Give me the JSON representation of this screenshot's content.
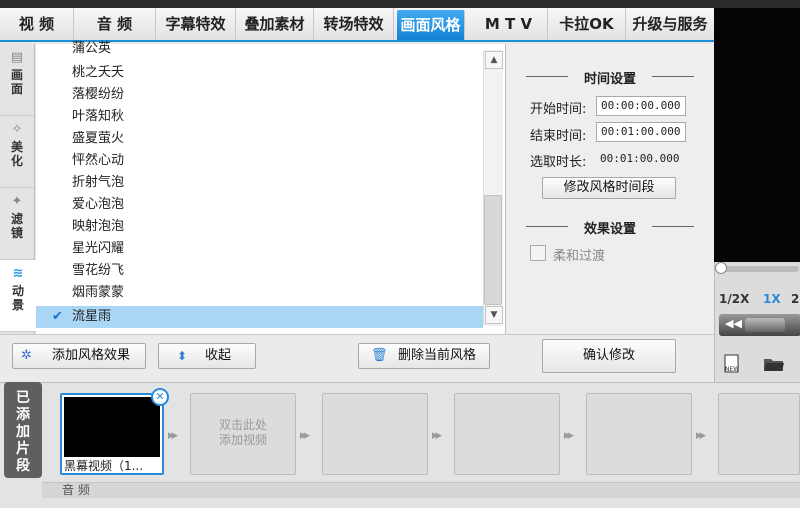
{
  "tabs": [
    {
      "label": "视 频"
    },
    {
      "label": "音 频"
    },
    {
      "label": "字幕特效"
    },
    {
      "label": "叠加素材"
    },
    {
      "label": "转场特效"
    },
    {
      "label": "画面风格"
    },
    {
      "label": "M T V"
    },
    {
      "label": "卡拉OK"
    },
    {
      "label": "升级与服务"
    }
  ],
  "sidebar": {
    "items": [
      {
        "label": "画\n面"
      },
      {
        "label": "美\n化"
      },
      {
        "label": "滤\n镜"
      },
      {
        "label": "动\n景"
      }
    ]
  },
  "effects": {
    "items": [
      "蒲公英",
      "桃之夭夭",
      "落樱纷纷",
      "叶落知秋",
      "盛夏萤火",
      "怦然心动",
      "折射气泡",
      "爱心泡泡",
      "映射泡泡",
      "星光闪耀",
      "雪花纷飞",
      "烟雨蒙蒙",
      "流星雨"
    ],
    "selected": "流星雨"
  },
  "time_settings": {
    "title": "时间设置",
    "start_label": "开始时间:",
    "start_value": "00:00:00.000",
    "end_label": "结束时间:",
    "end_value": "00:01:00.000",
    "duration_label": "选取时长:",
    "duration_value": "00:01:00.000",
    "modify_button": "修改风格时间段"
  },
  "effect_settings": {
    "title": "效果设置",
    "smooth_label": "柔和过渡",
    "smooth_checked": false
  },
  "actions": {
    "add_effect": "添加风格效果",
    "collapse": "收起",
    "delete_current": "删除当前风格",
    "confirm": "确认修改"
  },
  "preview": {
    "speeds": [
      "1/2X",
      "1X",
      "2"
    ],
    "active_speed": "1X"
  },
  "timeline": {
    "added_tab": "已\n添\n加\n片\n段",
    "clip1_label": "黑幕视频（1...",
    "add_hint": "双击此处\n添加视频",
    "audio_label": "音 频"
  }
}
